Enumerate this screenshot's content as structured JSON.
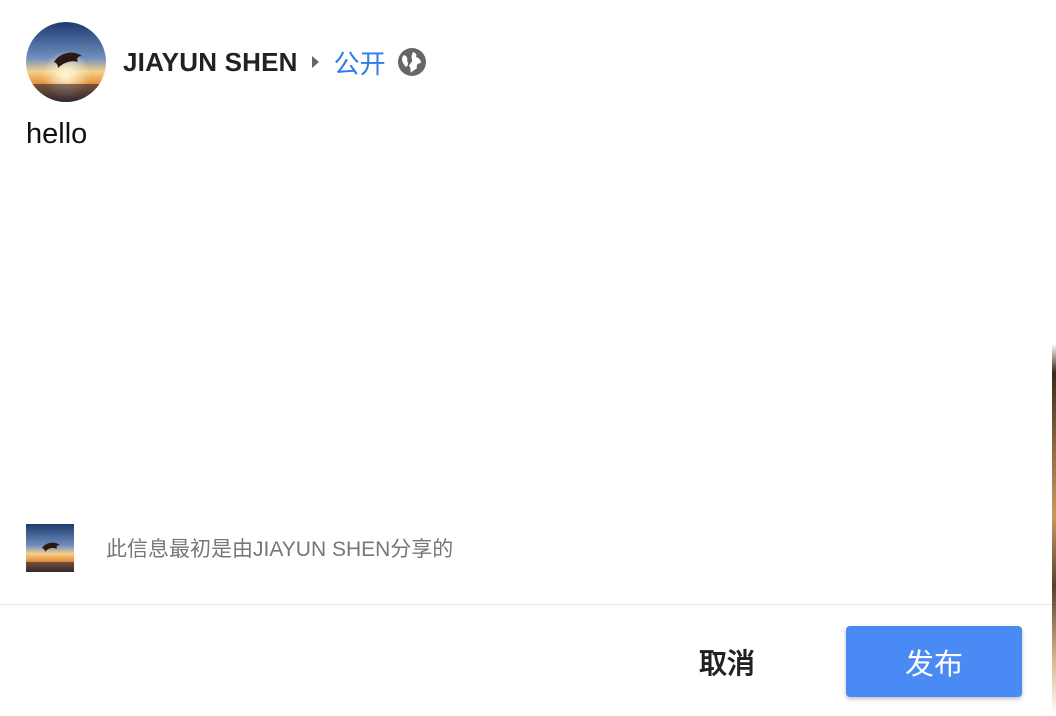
{
  "post": {
    "author_name": "JIAYUN SHEN",
    "audience": "公开",
    "audience_icon": "globe-icon",
    "text": "hello"
  },
  "share": {
    "note": "此信息最初是由JIAYUN SHEN分享的"
  },
  "actions": {
    "cancel_label": "取消",
    "post_label": "发布"
  },
  "colors": {
    "accent": "#4a8af4",
    "link": "#2b7de9"
  }
}
